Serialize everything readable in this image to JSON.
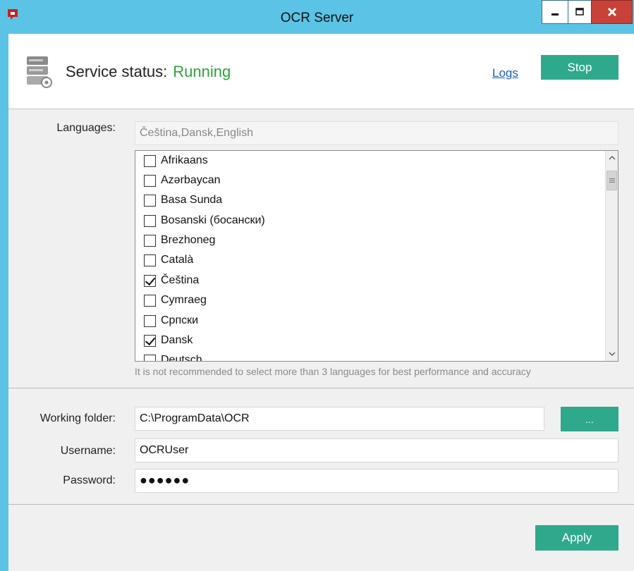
{
  "window": {
    "title": "OCR Server",
    "brand_color": "#c8201e",
    "titlebar_color": "#5bc4e6"
  },
  "status": {
    "label": "Service status:",
    "value": "Running",
    "value_color": "#2fa13c",
    "logs_link": "Logs",
    "stop_button": "Stop"
  },
  "languages": {
    "label": "Languages:",
    "selected_summary": "Čeština,Dansk,English",
    "items": [
      {
        "label": "Afrikaans",
        "checked": false
      },
      {
        "label": "Azərbaycan",
        "checked": false
      },
      {
        "label": "Basa Sunda",
        "checked": false
      },
      {
        "label": "Bosanski (босански)",
        "checked": false
      },
      {
        "label": "Brezhoneg",
        "checked": false
      },
      {
        "label": "Català",
        "checked": false
      },
      {
        "label": "Čeština",
        "checked": true
      },
      {
        "label": "Cymraeg",
        "checked": false
      },
      {
        "label": "Српски",
        "checked": false
      },
      {
        "label": "Dansk",
        "checked": true
      },
      {
        "label": "Deutsch",
        "checked": false
      }
    ],
    "hint": "It is not recommended to select more than 3 languages for best performance and accuracy"
  },
  "settings": {
    "working_folder_label": "Working folder:",
    "working_folder_value": "C:\\ProgramData\\OCR",
    "browse_button": "...",
    "username_label": "Username:",
    "username_value": "OCRUser",
    "password_label": "Password:",
    "password_masked": "●●●●●●"
  },
  "footer": {
    "apply_button": "Apply"
  },
  "accent_color": "#2ea98c"
}
